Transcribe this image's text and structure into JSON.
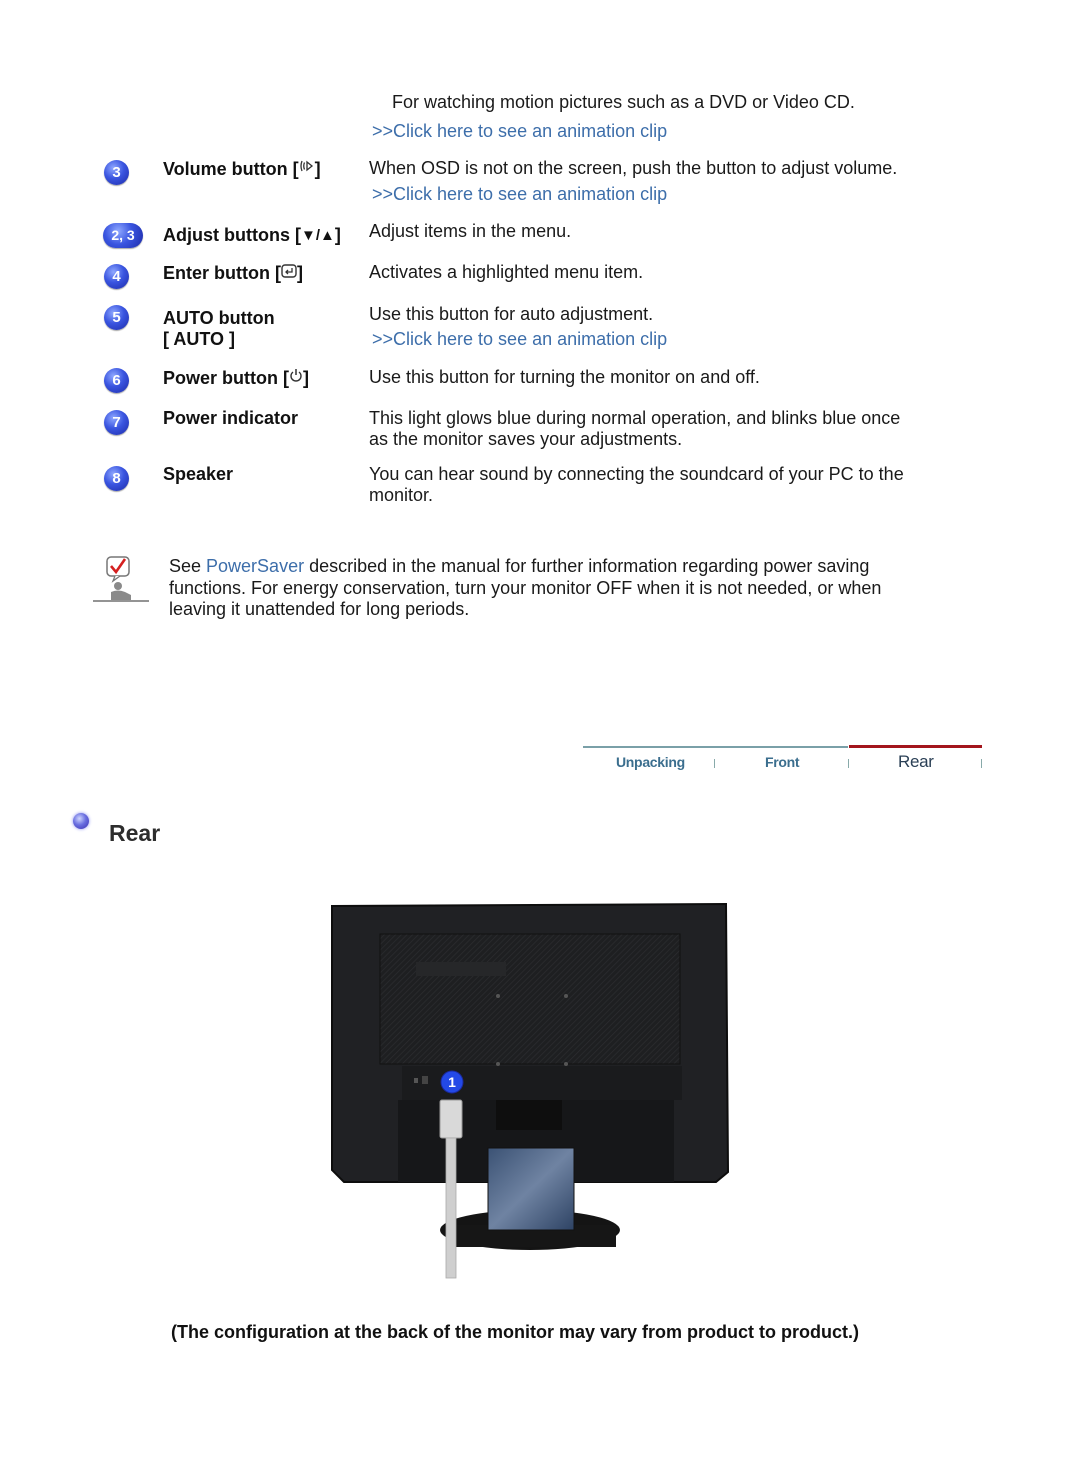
{
  "intro": {
    "description": "For watching motion pictures such as a DVD or Video CD.",
    "link": ">>Click here to see an animation clip"
  },
  "items": [
    {
      "badge": "3",
      "label": "Volume button [",
      "icon": "volume-icon",
      "label_suffix": "]",
      "description": "When OSD is not on the screen, push the button to adjust volume.",
      "link": ">>Click here to see an animation clip"
    },
    {
      "badge": "2, 3",
      "label": "Adjust buttons [",
      "icon": "down-up-arrows-icon",
      "icon_text": "▼/▲",
      "label_suffix": "]",
      "description": "Adjust items in the menu."
    },
    {
      "badge": "4",
      "label": "Enter button [",
      "icon": "enter-icon",
      "label_suffix": "]",
      "description": "Activates a highlighted menu item."
    },
    {
      "badge": "5",
      "label": "AUTO button",
      "label_line2": "[ AUTO ]",
      "description": "Use this button for auto adjustment.",
      "link": ">>Click here to see an animation clip"
    },
    {
      "badge": "6",
      "label": "Power button [",
      "icon": "power-icon",
      "label_suffix": "]",
      "description": "Use this button for turning the monitor on and off."
    },
    {
      "badge": "7",
      "label": "Power indicator",
      "description_line1": "This light glows blue during normal operation, and blinks blue once",
      "description_line2": "as the monitor saves your adjustments."
    },
    {
      "badge": "8",
      "label": "Speaker",
      "description_line1": "You can hear sound by connecting the soundcard of your PC to the",
      "description_line2": "monitor."
    }
  ],
  "note": {
    "icon": "note-checkmark-icon",
    "prefix": "See ",
    "link": "PowerSaver",
    "line1_rest": " described in the manual for further information regarding power saving",
    "line2": "functions. For energy conservation, turn your monitor OFF when it is not needed, or when",
    "line3": "leaving it unattended for long periods."
  },
  "nav": {
    "tabs": [
      {
        "label": "Unpacking",
        "active": false
      },
      {
        "label": "Front",
        "active": false
      },
      {
        "label": "Rear",
        "active": true
      }
    ],
    "colors": {
      "active_line": "#a3151c",
      "inactive_line": "#7aa0a8"
    }
  },
  "section": {
    "title": "Rear",
    "image_alt": "Rear view of monitor",
    "callout_badge": "1"
  },
  "caption": "(The configuration at the back of the monitor may vary from product to product.)"
}
